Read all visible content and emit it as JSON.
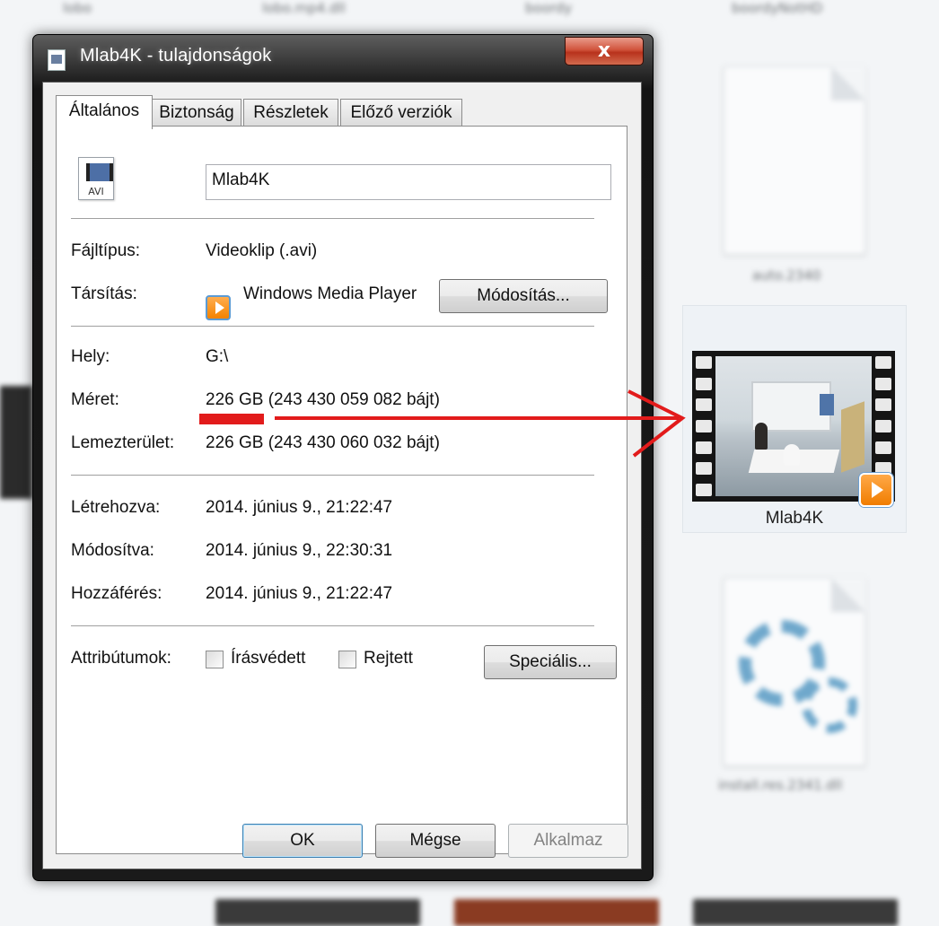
{
  "background": {
    "top_labels": [
      "lobo",
      "lobo.mp4.dll",
      "boordy",
      "boordyNotHD"
    ],
    "file_labels": {
      "doc": "auto.2340",
      "installer": "install.res.2341.dll"
    }
  },
  "selected_file": {
    "name": "Mlab4K",
    "badge_icon": "wmp-play-icon"
  },
  "dialog": {
    "title": "Mlab4K - tulajdonságok",
    "close_label": "x",
    "tabs": [
      {
        "label": "Általános",
        "active": true
      },
      {
        "label": "Biztonság",
        "active": false
      },
      {
        "label": "Részletek",
        "active": false
      },
      {
        "label": "Előző verziók",
        "active": false
      }
    ],
    "file_icon_text": "AVI",
    "file_name_value": "Mlab4K",
    "rows": {
      "type": {
        "label": "Fájltípus:",
        "value": "Videoklip (.avi)"
      },
      "opens_with": {
        "label": "Társítás:",
        "value": "Windows Media Player",
        "button": "Módosítás..."
      },
      "location": {
        "label": "Hely:",
        "value": "G:\\"
      },
      "size": {
        "label": "Méret:",
        "value": "226 GB (243 430 059 082 bájt)"
      },
      "size_on_disk": {
        "label": "Lemezterület:",
        "value": "226 GB (243 430 060 032 bájt)"
      },
      "created": {
        "label": "Létrehozva:",
        "value": "2014. június 9., 21:22:47"
      },
      "modified": {
        "label": "Módosítva:",
        "value": "2014. június 9., 22:30:31"
      },
      "accessed": {
        "label": "Hozzáférés:",
        "value": "2014. június 9., 21:22:47"
      }
    },
    "attributes": {
      "label": "Attribútumok:",
      "readonly": {
        "label": "Írásvédett",
        "checked": false
      },
      "hidden": {
        "label": "Rejtett",
        "checked": false
      },
      "advanced_button": "Speciális..."
    },
    "buttons": {
      "ok": "OK",
      "cancel": "Mégse",
      "apply": "Alkalmaz"
    }
  },
  "annotation": {
    "color": "#e21b1b"
  }
}
